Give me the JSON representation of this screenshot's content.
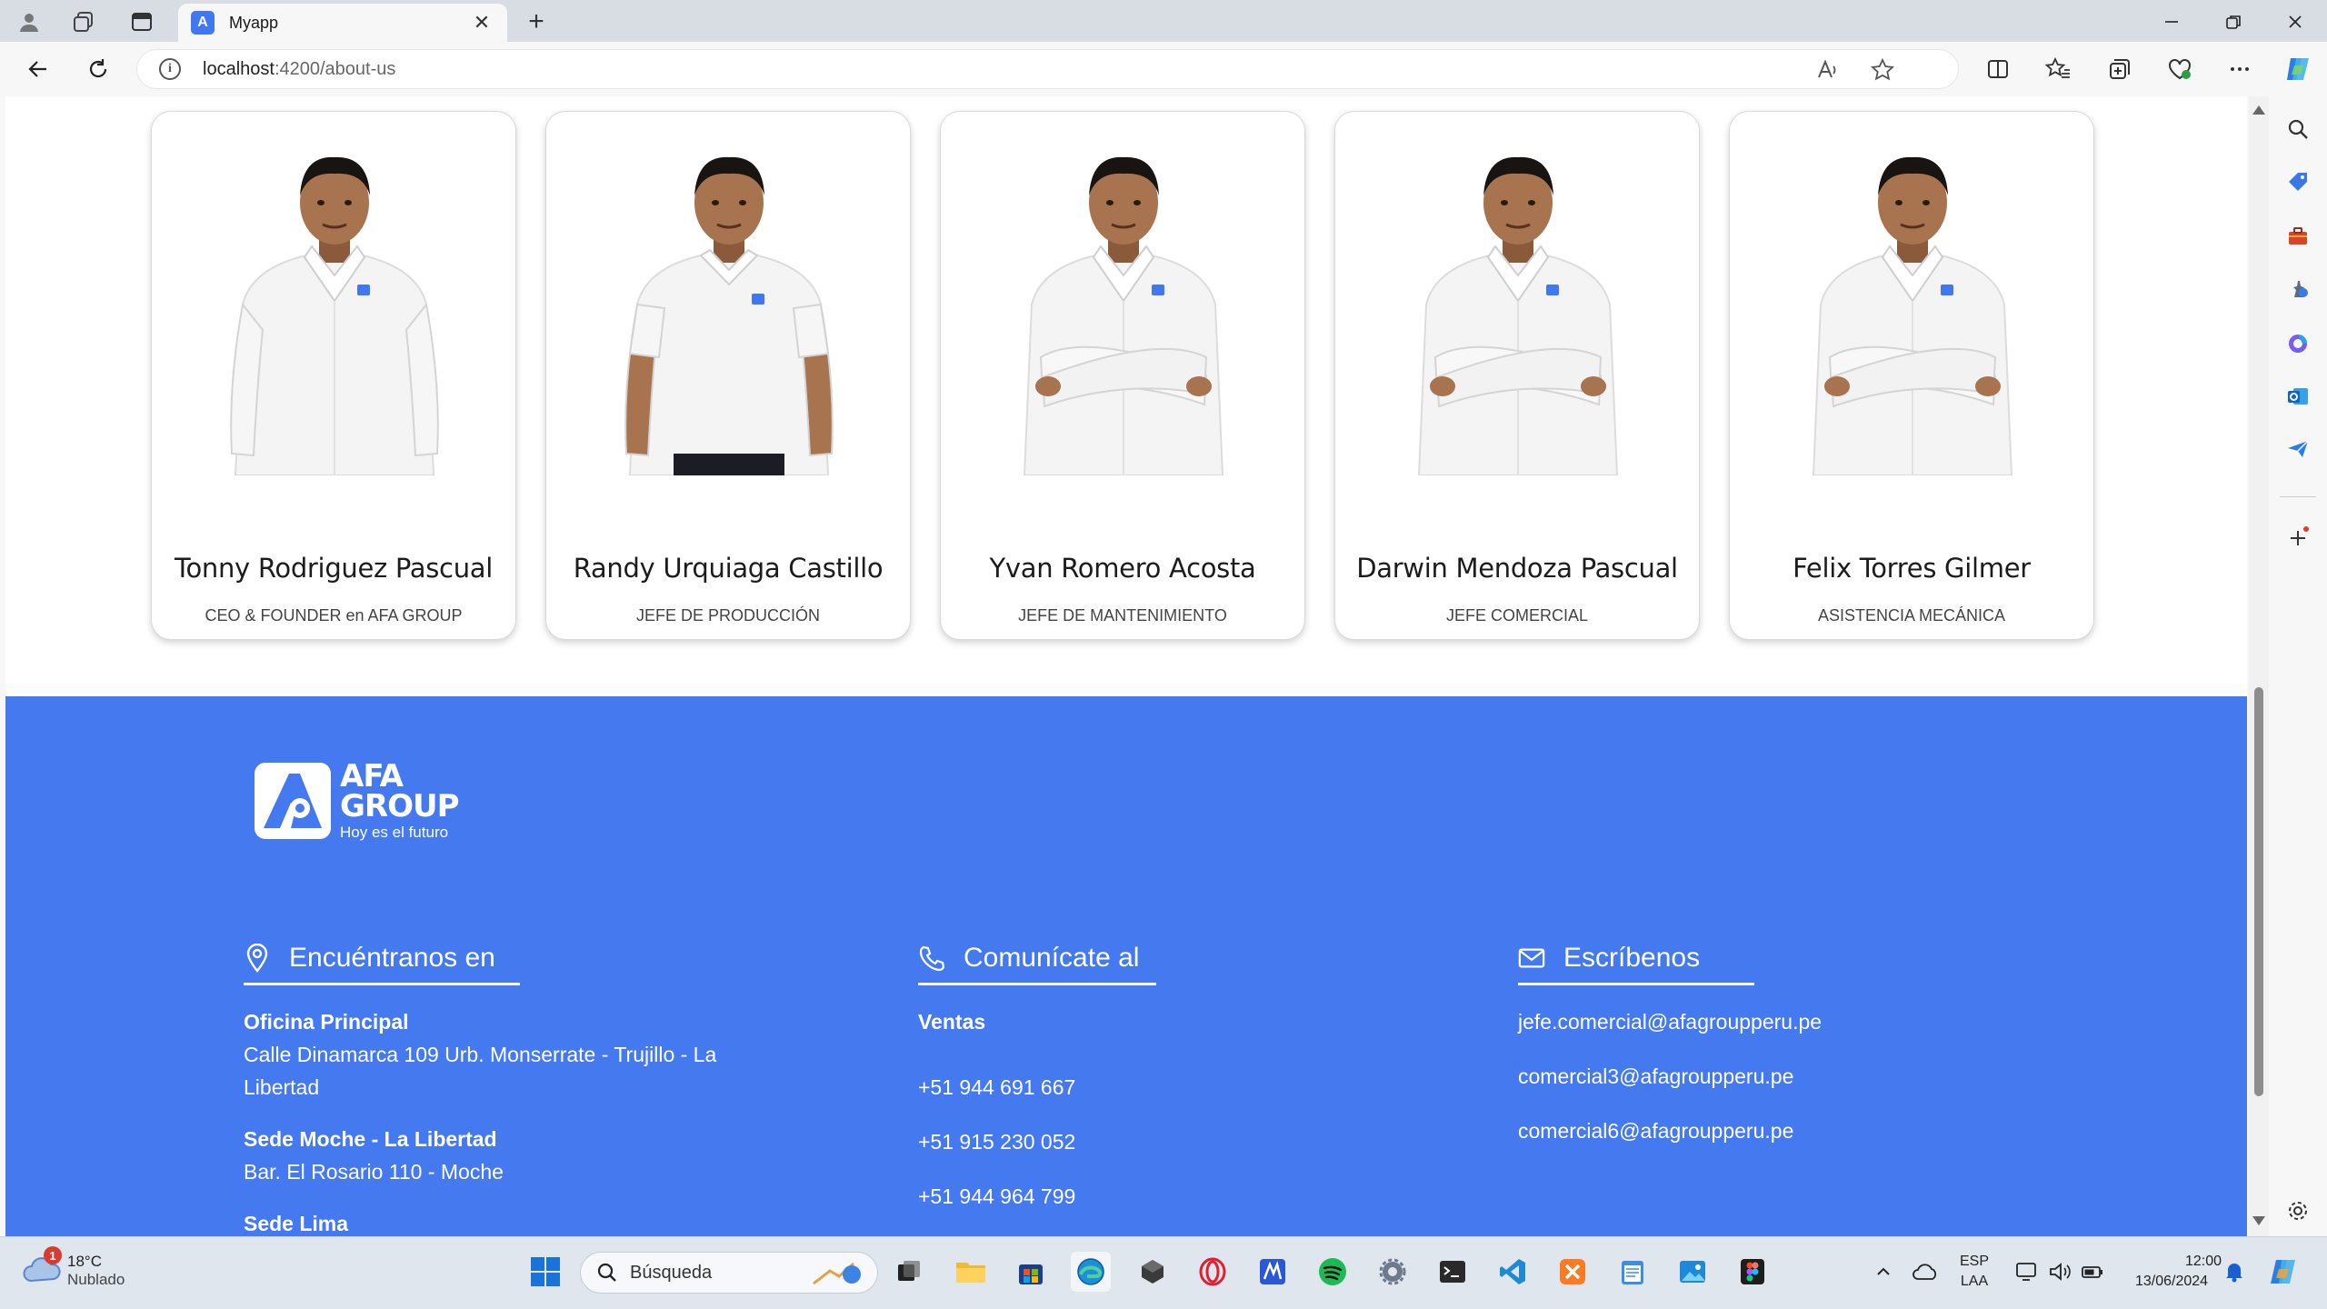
{
  "browser": {
    "tab_title": "Myapp",
    "favicon_letter": "A",
    "url_host": "localhost",
    "url_path": ":4200/about-us"
  },
  "team": [
    {
      "name": "Tonny Rodriguez Pascual",
      "role": "CEO & FOUNDER en AFA GROUP",
      "shirt": "dress-shirt",
      "pose": "hands-down"
    },
    {
      "name": "Randy Urquiaga Castillo",
      "role": "JEFE DE PRODUCCIÓN",
      "shirt": "polo",
      "pose": "hands-down"
    },
    {
      "name": "Yvan Romero Acosta",
      "role": "JEFE DE MANTENIMIENTO",
      "shirt": "dress-shirt",
      "pose": "arms-crossed"
    },
    {
      "name": "Darwin Mendoza Pascual",
      "role": "JEFE COMERCIAL",
      "shirt": "dress-shirt",
      "pose": "arms-crossed"
    },
    {
      "name": "Felix Torres Gilmer",
      "role": "ASISTENCIA MECÁNICA",
      "shirt": "dress-shirt",
      "pose": "arms-crossed"
    }
  ],
  "footer": {
    "brand": {
      "line1": "AFA",
      "line2": "GROUP",
      "tagline": "Hoy es el futuro"
    },
    "bg_color": "#4479f0",
    "locations": {
      "heading": "Encuéntranos en",
      "icon": "map-pin-icon",
      "items": [
        {
          "title": "Oficina Principal",
          "address": "Calle Dinamarca 109 Urb. Monserrate - Trujillo - La Libertad"
        },
        {
          "title": "Sede Moche - La Libertad",
          "address": "Bar. El Rosario 110 - Moche"
        },
        {
          "title": "Sede Lima",
          "address": ""
        }
      ]
    },
    "phones": {
      "heading": "Comunícate al",
      "icon": "phone-icon",
      "subtitle": "Ventas",
      "numbers": [
        "+51 944 691 667",
        "+51 915 230 052",
        "+51 944 964 799"
      ]
    },
    "emails": {
      "heading": "Escríbenos",
      "icon": "mail-icon",
      "addresses": [
        "jefe.comercial@afagroupperu.pe",
        "comercial3@afagroupperu.pe",
        "comercial6@afagroupperu.pe"
      ]
    }
  },
  "taskbar": {
    "weather_temp": "18°C",
    "weather_cond": "Nublado",
    "weather_badge": "1",
    "search_placeholder": "Búsqueda",
    "lang_line1": "ESP",
    "lang_line2": "LAA",
    "time": "12:00",
    "date": "13/06/2024"
  }
}
